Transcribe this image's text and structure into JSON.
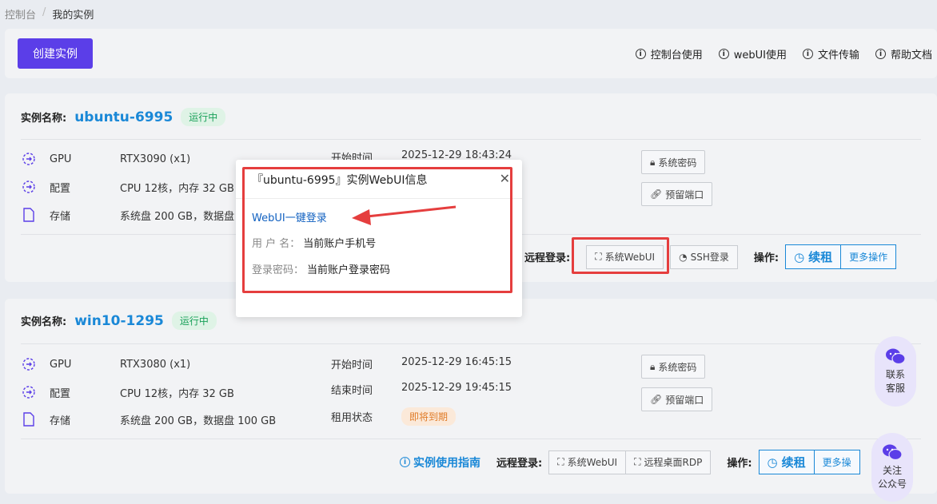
{
  "breadcrumb": {
    "root": "控制台",
    "current": "我的实例"
  },
  "toolbar": {
    "create_label": "创建实例",
    "links": [
      "控制台使用",
      "webUI使用",
      "文件传输",
      "帮助文档"
    ]
  },
  "instances": [
    {
      "name_label": "实例名称:",
      "name": "ubuntu-6995",
      "status": "运行中",
      "specs": [
        {
          "label": "GPU",
          "value": "RTX3090 (x1)"
        },
        {
          "label": "配置",
          "value": "CPU 12核，内存 32 GB"
        },
        {
          "label": "存储",
          "value": "系统盘 200 GB，数据盘"
        }
      ],
      "start_label": "开始时间",
      "start_value": "2025-12-29 18:43:24",
      "sys_password": "系统密码",
      "reserve_port": "预留端口",
      "remote_label": "远程登录:",
      "remote_buttons": [
        "系统WebUI",
        "SSH登录"
      ],
      "ops_label": "操作:",
      "renew": "续租",
      "more": "更多操作"
    },
    {
      "name_label": "实例名称:",
      "name": "win10-1295",
      "status": "运行中",
      "specs": [
        {
          "label": "GPU",
          "value": "RTX3080 (x1)"
        },
        {
          "label": "配置",
          "value": "CPU 12核，内存 32 GB"
        },
        {
          "label": "存储",
          "value": "系统盘 200 GB，数据盘 100 GB"
        }
      ],
      "start_label": "开始时间",
      "start_value": "2025-12-29 16:45:15",
      "end_label": "结束时间",
      "end_value": "2025-12-29 19:45:15",
      "rent_label": "租用状态",
      "rent_value": "即将到期",
      "sys_password": "系统密码",
      "reserve_port": "预留端口",
      "guide": "实例使用指南",
      "remote_label": "远程登录:",
      "remote_buttons": [
        "系统WebUI",
        "远程桌面RDP"
      ],
      "ops_label": "操作:",
      "renew": "续租",
      "more": "更多操"
    }
  ],
  "popup": {
    "title": "『ubuntu-6995』实例WebUI信息",
    "link": "WebUI一键登录",
    "user_label": "用 户 名：",
    "user_value": "当前账户手机号",
    "pass_label": "登录密码：",
    "pass_value": "当前账户登录密码"
  },
  "floating": {
    "service": [
      "联系",
      "客服"
    ],
    "follow": [
      "关注",
      "公众号"
    ]
  },
  "colors": {
    "accent": "#5b3ee8",
    "link": "#1a88d7",
    "highlight": "#e53e3e"
  }
}
